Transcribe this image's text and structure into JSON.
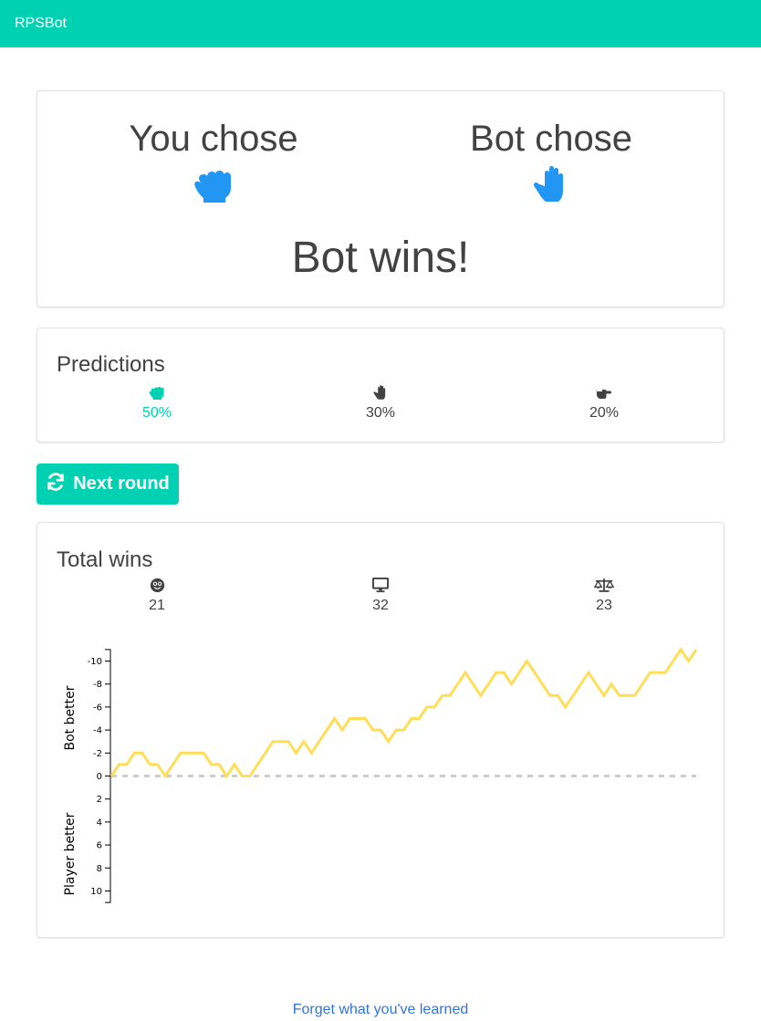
{
  "app": {
    "brand": "RPSBot",
    "accent": "#00d1b2"
  },
  "result_card": {
    "you_chose_label": "You chose",
    "you_choice_icon": "hand-rock-icon",
    "bot_chose_label": "Bot chose",
    "bot_choice_icon": "hand-paper-icon",
    "outcome": "Bot wins!",
    "icon_color": "#2196f3"
  },
  "predictions": {
    "title": "Predictions",
    "items": [
      {
        "icon": "hand-rock-icon",
        "value": "50%",
        "active": true
      },
      {
        "icon": "hand-paper-icon",
        "value": "30%",
        "active": false
      },
      {
        "icon": "hand-scissors-icon",
        "value": "20%",
        "active": false
      }
    ]
  },
  "next_round": {
    "label": "Next round",
    "icon": "sync-icon"
  },
  "total_wins": {
    "title": "Total wins",
    "items": [
      {
        "icon": "smiley-icon",
        "value": "21"
      },
      {
        "icon": "desktop-icon",
        "value": "32"
      },
      {
        "icon": "balance-scale-icon",
        "value": "23"
      }
    ]
  },
  "chart_data": {
    "type": "line",
    "title": "",
    "ylabel_top": "Bot better",
    "ylabel_bottom": "Player better",
    "y_ticks": [
      "-10",
      "-8",
      "-6",
      "-4",
      "-2",
      "0",
      "2",
      "4",
      "6",
      "8",
      "10"
    ],
    "ylim": [
      -11,
      11
    ],
    "line_color": "#ffdd57",
    "baseline": 0,
    "x": "round",
    "values": [
      0,
      -1,
      -1,
      -2,
      -2,
      -1,
      -1,
      0,
      -1,
      -2,
      -2,
      -2,
      -2,
      -1,
      -1,
      0,
      -1,
      0,
      0,
      -1,
      -2,
      -3,
      -3,
      -3,
      -2,
      -3,
      -2,
      -3,
      -4,
      -5,
      -4,
      -5,
      -5,
      -5,
      -4,
      -4,
      -3,
      -4,
      -4,
      -5,
      -5,
      -6,
      -6,
      -7,
      -7,
      -8,
      -9,
      -8,
      -7,
      -8,
      -9,
      -9,
      -8,
      -9,
      -10,
      -9,
      -8,
      -7,
      -7,
      -6,
      -7,
      -8,
      -9,
      -8,
      -7,
      -8,
      -7,
      -7,
      -7,
      -8,
      -9,
      -9,
      -9,
      -10,
      -11,
      -10,
      -11
    ]
  },
  "footer": {
    "forget_label": "Forget what you've learned"
  }
}
